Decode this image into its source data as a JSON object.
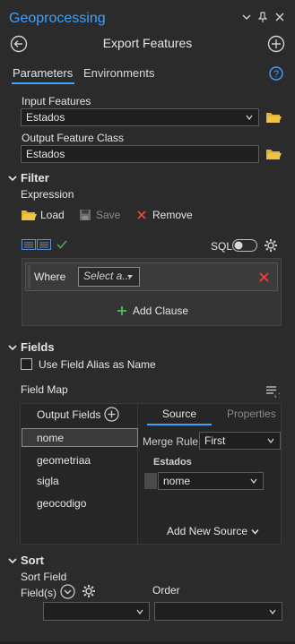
{
  "pane": {
    "title": "Geoprocessing",
    "tool_title": "Export Features"
  },
  "tabs": {
    "parameters": "Parameters",
    "environments": "Environments"
  },
  "params": {
    "input_features_label": "Input Features",
    "input_features_value": "Estados",
    "output_fc_label": "Output Feature Class",
    "output_fc_value": "Estados"
  },
  "filter": {
    "header": "Filter",
    "expression_label": "Expression",
    "load_label": "Load",
    "save_label": "Save",
    "remove_label": "Remove",
    "sql_label": "SQL",
    "where_label": "Where",
    "select_placeholder": "Select a...",
    "add_clause_label": "Add Clause"
  },
  "fields": {
    "header": "Fields",
    "alias_checkbox_label": "Use Field Alias as Name",
    "field_map_label": "Field Map",
    "output_fields_header": "Output Fields",
    "items": [
      "nome",
      "geometriaa",
      "sigla",
      "geocodigo"
    ],
    "source_tab": "Source",
    "properties_tab": "Properties",
    "merge_rule_label": "Merge Rule",
    "merge_rule_value": "First",
    "source_group": "Estados",
    "source_field_value": "nome",
    "add_new_source_label": "Add New Source"
  },
  "sort": {
    "header": "Sort",
    "sort_field_label": "Sort Field",
    "fields_label": "Field(s)",
    "order_label": "Order"
  },
  "colors": {
    "accent": "#3ea1ff",
    "background": "#2b2b2b",
    "remove_red": "#e8453c",
    "add_green": "#4caf50",
    "folder_yellow": "#f0c343"
  }
}
